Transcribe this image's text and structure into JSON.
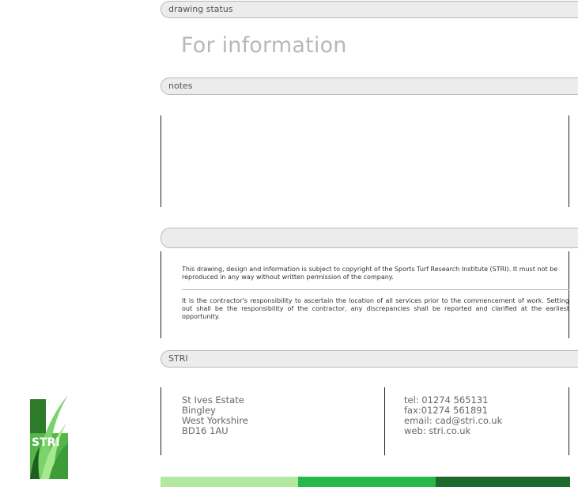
{
  "sections": {
    "drawing_status_label": "drawing status",
    "drawing_status_value": "For information",
    "notes_label": "notes",
    "blank_label": "",
    "stri_label": "STRI"
  },
  "copyright": {
    "notice": "This drawing, design and information is subject to copyright of the Sports Turf Research Institute (STRI). It must not be reproduced in any way without written permission of the company.",
    "responsibility": "It is the contractor's responsibility to ascertain the location of all services prior to the commencement of work. Setting out shall be the responsibility of the contractor, any discrepancies shall be reported and clarified at the earliest opportunity."
  },
  "address": {
    "line1": "St Ives Estate",
    "line2": "Bingley",
    "line3": "West Yorkshire",
    "line4": "BD16 1AU"
  },
  "contact": {
    "tel": "tel: 01274 565131",
    "fax": "fax:01274 561891",
    "email": "email: cad@stri.co.uk",
    "web": "web: stri.co.uk"
  },
  "logo": {
    "text": "STRI",
    "icon": "stri-grass-logo-icon"
  },
  "colors": {
    "bar_light": "#b3e8a0",
    "bar_mid": "#27b84a",
    "bar_dark": "#1b6b2c",
    "logo_green": "#2f8a2b"
  }
}
